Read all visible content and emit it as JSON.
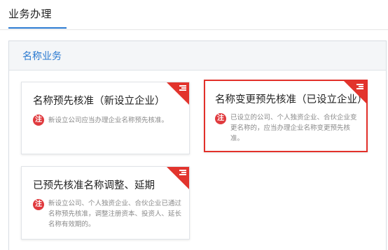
{
  "tabs": {
    "active": "业务办理"
  },
  "section": {
    "title": "名称业务"
  },
  "cards": [
    {
      "title": "名称预先核准（新设立企业）",
      "note_badge": "注",
      "description": "新设立公司应当办理企业名称预先核准。"
    },
    {
      "title": "名称变更预先核准（已设立企业）",
      "note_badge": "注",
      "description": "已设立的公司、个人独资企业、合伙企业变更名称的，应当办理企业名称变更预先核准。"
    },
    {
      "title": "已预先核准名称调整、延期",
      "note_badge": "注",
      "description": "新设立公司、个人独资企业、合伙企业已通过名称预先核准，调整注册资本、投资人、延长名称有效期的。"
    }
  ],
  "colors": {
    "accent": "#2a79d0",
    "corner": "#e2342d",
    "selected_border": "#e2302a",
    "badge": "#e03a3e"
  },
  "icons": {
    "corner": "menu-lines-icon"
  }
}
